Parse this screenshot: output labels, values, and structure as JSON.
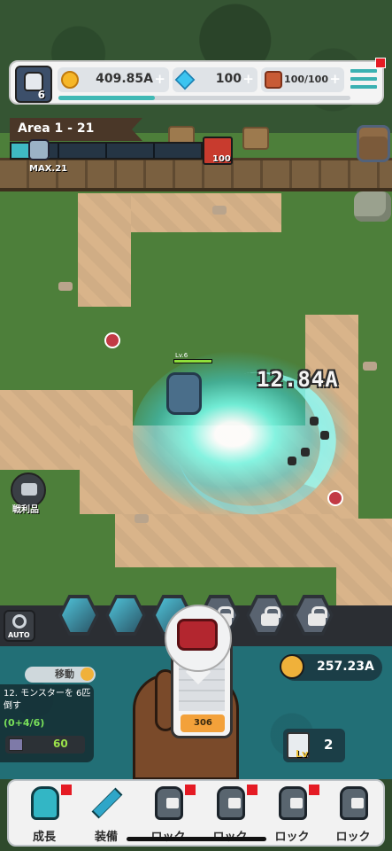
{
  "hud": {
    "player_level": "6",
    "gold": "409.85A",
    "gems": "100",
    "tickets": "100/100",
    "plus": "+",
    "xp_progress": 0.33
  },
  "stage": {
    "area_label": "Area 1 - 21",
    "max_label": "MAX.21",
    "boss_count": "100",
    "progress": 0.2
  },
  "battle": {
    "hero_level": "Lv.6",
    "damage_text": "12.84A"
  },
  "loot": {
    "label": "戦利品"
  },
  "skills": {
    "auto_label": "AUTO",
    "slots": [
      {
        "state": "unlocked"
      },
      {
        "state": "unlocked"
      },
      {
        "state": "unlocked"
      },
      {
        "state": "locked"
      },
      {
        "state": "locked"
      },
      {
        "state": "locked"
      }
    ]
  },
  "quest": {
    "move_label": "移動",
    "title": "12. モンスターを 6匹倒す",
    "progress": "(0+4/6)",
    "reward": "60"
  },
  "power": {
    "value": "257.23A"
  },
  "summon": {
    "price": "306"
  },
  "level_card": {
    "lv": "Lv",
    "count": "2"
  },
  "nav": {
    "items": [
      {
        "label": "成長",
        "icon": "knight-icon",
        "badge": true
      },
      {
        "label": "装備",
        "icon": "sword-icon",
        "badge": false
      },
      {
        "label": "ロック",
        "icon": "locked-icon",
        "badge": true
      },
      {
        "label": "ロック",
        "icon": "locked-icon",
        "badge": true
      },
      {
        "label": "ロック",
        "icon": "locked-icon",
        "badge": true
      },
      {
        "label": "ロック",
        "icon": "locked-icon",
        "badge": false
      }
    ]
  },
  "colors": {
    "accent": "#3ab1b2",
    "panel": "#226f76",
    "badge": "#e51b24",
    "quest_progress": "#79e05a"
  }
}
